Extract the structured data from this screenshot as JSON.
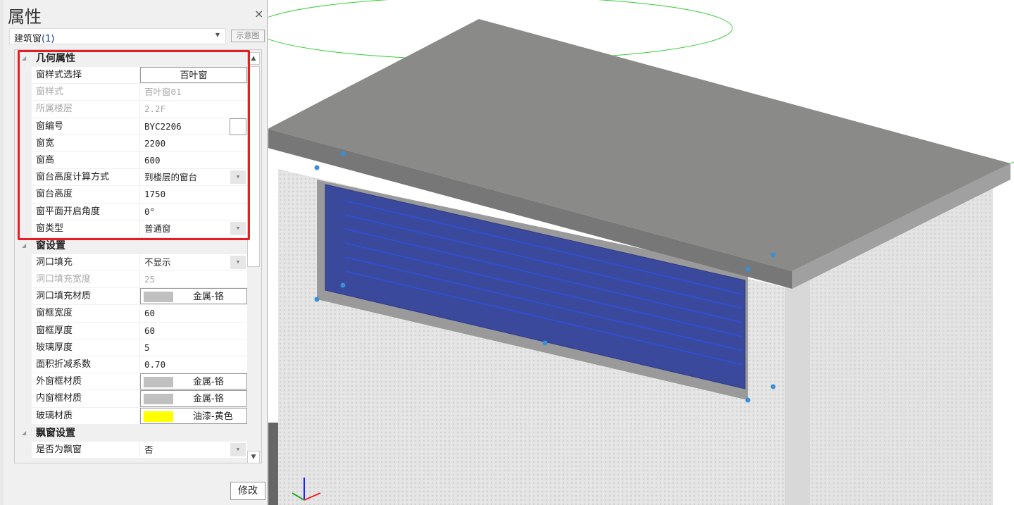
{
  "panel": {
    "title": "属性",
    "close": "×",
    "selector": {
      "label": "建筑窗",
      "count": "(1)"
    },
    "diagram_button": "示意图",
    "modify_button": "修改",
    "sections": [
      {
        "title": "几何属性",
        "rows": [
          {
            "key": "窗样式选择",
            "value": "百叶窗",
            "type": "button"
          },
          {
            "key": "窗样式",
            "value": "百叶窗01",
            "disabled": true
          },
          {
            "key": "所属楼层",
            "value": "2.2F",
            "disabled": true
          },
          {
            "key": "窗编号",
            "value": "BYC2206",
            "type": "box"
          },
          {
            "key": "窗宽",
            "value": "2200"
          },
          {
            "key": "窗高",
            "value": "600"
          },
          {
            "key": "窗台高度计算方式",
            "value": "到楼层的窗台",
            "type": "dropdown"
          },
          {
            "key": "窗台高度",
            "value": "1750"
          },
          {
            "key": "窗平面开启角度",
            "value": "0°"
          },
          {
            "key": "窗类型",
            "value": "普通窗",
            "type": "dropdown"
          }
        ]
      },
      {
        "title": "窗设置",
        "rows": [
          {
            "key": "洞口填充",
            "value": "不显示",
            "type": "dropdown"
          },
          {
            "key": "洞口填充宽度",
            "value": "25",
            "disabled": true
          },
          {
            "key": "洞口填充材质",
            "value": "金属-铬",
            "type": "material",
            "swatch": "#c0c0c0"
          },
          {
            "key": "窗框宽度",
            "value": "60"
          },
          {
            "key": "窗框厚度",
            "value": "60"
          },
          {
            "key": "玻璃厚度",
            "value": "5"
          },
          {
            "key": "面积折减系数",
            "value": "0.70"
          },
          {
            "key": "外窗框材质",
            "value": "金属-铬",
            "type": "material",
            "swatch": "#c0c0c0"
          },
          {
            "key": "内窗框材质",
            "value": "金属-铬",
            "type": "material",
            "swatch": "#c0c0c0"
          },
          {
            "key": "玻璃材质",
            "value": "油漆-黄色",
            "type": "material",
            "swatch": "#ffff00"
          }
        ]
      },
      {
        "title": "飘窗设置",
        "rows": [
          {
            "key": "是否为飘窗",
            "value": "否",
            "type": "dropdown"
          }
        ]
      }
    ]
  },
  "colors": {
    "highlight": "#e81c24",
    "glass": "#1a2f9c",
    "grip": "#3a8fd6"
  }
}
